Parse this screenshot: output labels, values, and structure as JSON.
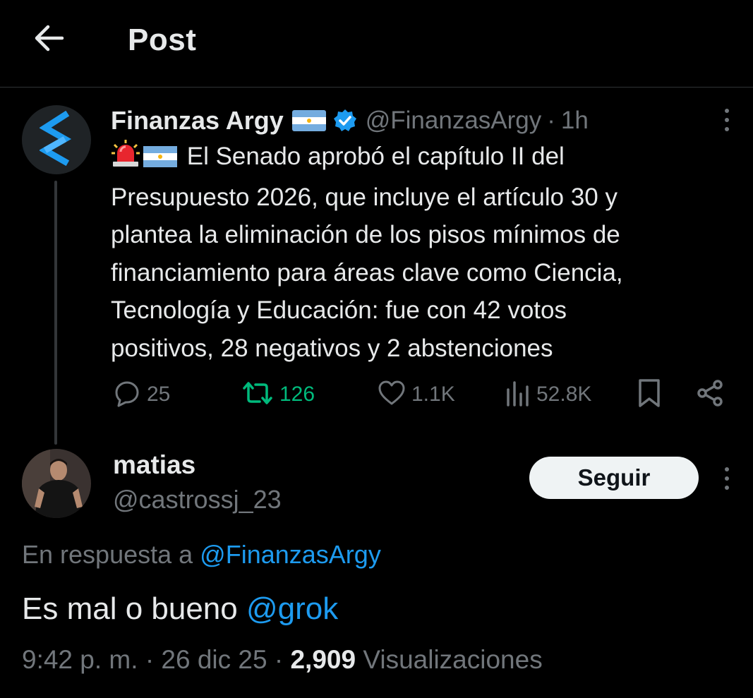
{
  "header": {
    "title": "Post"
  },
  "parent_tweet": {
    "author_name": "Finanzas Argy",
    "author_handle": "@FinanzasArgy",
    "separator": "·",
    "time": "1h",
    "text_lines": [
      "El Senado aprobó el capítulo II del",
      "Presupuesto 2026, que incluye el artículo 30 y",
      "plantea la eliminación de los pisos mínimos de",
      "financiamiento para áreas clave como Ciencia,",
      "Tecnología y Educación: fue con 42 votos",
      "positivos, 28 negativos y 2 abstenciones"
    ],
    "stats": {
      "replies": "25",
      "retweets": "126",
      "likes": "1.1K",
      "views": "52.8K"
    },
    "icons": [
      "siren-emoji",
      "argentina-flag",
      "verified-badge",
      "reply-icon",
      "retweet-icon",
      "like-icon",
      "views-icon",
      "bookmark-icon",
      "share-icon",
      "more-icon"
    ]
  },
  "reply": {
    "author_name": "matias",
    "author_handle": "@castrossj_23",
    "follow_label": "Seguir",
    "in_reply_prefix": "En respuesta a",
    "in_reply_handle": "@FinanzasArgy",
    "text": "Es mal o bueno",
    "mention": "@grok",
    "time": "9:42 p. m.",
    "separator": "·",
    "date": "26 dic 25",
    "views_count": "2,909",
    "views_label": "Visualizaciones"
  },
  "colors": {
    "background": "#000000",
    "text": "#e7e9ea",
    "muted": "#71767b",
    "link": "#1d9bf0",
    "retweet": "#00ba7c",
    "divider": "#2f3336"
  }
}
